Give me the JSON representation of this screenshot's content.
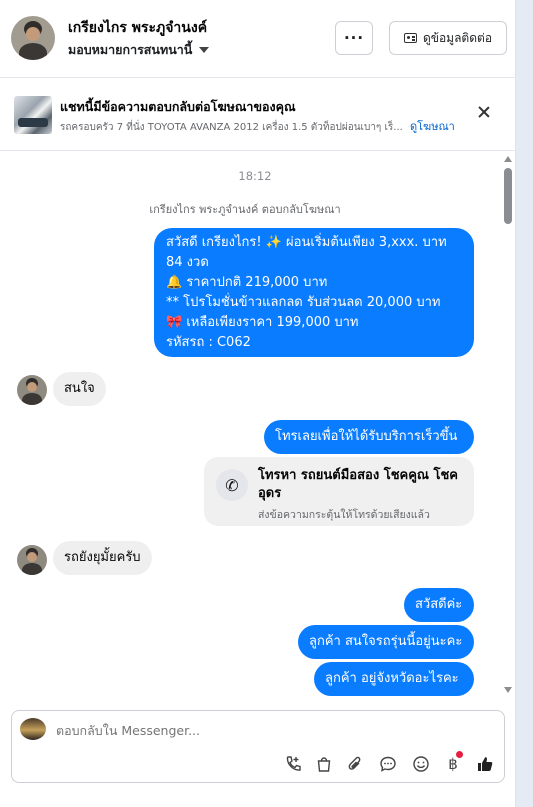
{
  "header": {
    "name": "เกรียงไกร พระภูจำนงค์",
    "assign_label": "มอบหมายการสนทนานี้",
    "more_label": "···",
    "contact_label": "ดูข้อมูลติดต่อ"
  },
  "ad": {
    "title": "แชทนี้มีข้อความตอบกลับต่อโฆษณาของคุณ",
    "subtitle": "รถครอบครัว 7 ที่นั่ง TOYOTA AVANZA 2012 เครื่อง 1.5 ตัวท็อปผ่อนเบาๆ เร็...",
    "link": "ดูโฆษณา"
  },
  "thread": {
    "time": "18:12",
    "reply_note": "เกรียงไกร พระภูจำนงค์ ตอบกลับโฆษณา",
    "ad_message": {
      "line1": "สวัสดี เกรียงไกร! ✨  ผ่อนเริ่มต้นเพียง 3,xxx. บาท",
      "line2": "84 งวด",
      "line3": "🔔 ราคาปกติ 219,000 บาท",
      "line4": "** โปรโมชั่นข้าวแลกลด รับส่วนลด 20,000 บาท",
      "line5": "🎀  เหลือเพียงราคา 199,000 บาท",
      "line6": " รหัสรถ : C062"
    },
    "msg_interested": "สนใจ",
    "msg_call_prompt": "โทรเลยเพื่อให้ได้รับบริการเร็วขึ้น",
    "call_card": {
      "title": "โทรหา รถยนต์มือสอง โชคคูณ โชค อุดร",
      "subtitle": "ส่งข้อความกระตุ้นให้โทรด้วยเสียงแล้ว"
    },
    "msg_still_available": "รถยังยุมั้ยครับ",
    "msg_hello": "สวัสดีค่ะ",
    "msg_which_model": "ลูกค้า สนใจรถรุ่นนี้อยู่นะคะ",
    "msg_which_province": "ลูกค้า อยู่จังหวัดอะไรคะ"
  },
  "composer": {
    "placeholder": "ตอบกลับใน Messenger..."
  },
  "icons": [
    "phone-plus-icon",
    "bag-icon",
    "paperclip-icon",
    "chat-bubble-icon",
    "emoji-icon",
    "baht-icon",
    "thumbs-up-icon"
  ],
  "colors": {
    "outgoing_bubble": "#0a7cff",
    "incoming_bubble": "#efefef",
    "link": "#0064d1"
  }
}
